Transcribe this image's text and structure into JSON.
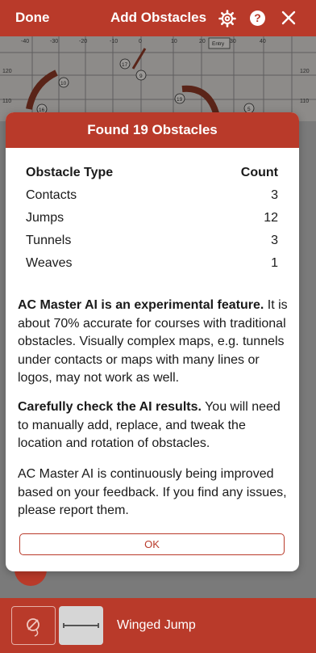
{
  "topbar": {
    "done_label": "Done",
    "title": "Add Obstacles",
    "help_glyph": "?",
    "icons": [
      "gear-icon",
      "help-icon",
      "close-icon"
    ]
  },
  "map": {
    "x_ticks": [
      "-40",
      "-30",
      "-20",
      "-10",
      "0",
      "10",
      "20",
      "30",
      "40"
    ],
    "y_ticks": [
      "120",
      "110"
    ],
    "entry_label": "Entry",
    "obstacle_numbers": [
      "17",
      "9",
      "10",
      "19",
      "16",
      "5"
    ]
  },
  "modal": {
    "title": "Found 19 Obstacles",
    "table": {
      "headers": [
        "Obstacle Type",
        "Count"
      ],
      "rows": [
        {
          "type": "Contacts",
          "count": "3"
        },
        {
          "type": "Jumps",
          "count": "12"
        },
        {
          "type": "Tunnels",
          "count": "3"
        },
        {
          "type": "Weaves",
          "count": "1"
        }
      ]
    },
    "para1_bold": "AC Master AI is an experimental feature.",
    "para1_rest": " It is about 70% accurate for courses with traditional obstacles. Visually complex maps, e.g. tunnels under contacts or maps with many lines or logos, may not work as well.",
    "para2_bold": "Carefully check the AI results.",
    "para2_rest": " You will need to manually add, replace, and tweak the location and rotation of obstacles.",
    "para3": "AC Master AI is continuously being improved based on your feedback. If you find any issues, please report them.",
    "ok_label": "OK"
  },
  "bottombar": {
    "selected_obstacle": "Winged Jump"
  },
  "colors": {
    "accent": "#b93a2a",
    "overlay": "#7a7a7a",
    "map_paper": "#e9e5e1"
  }
}
